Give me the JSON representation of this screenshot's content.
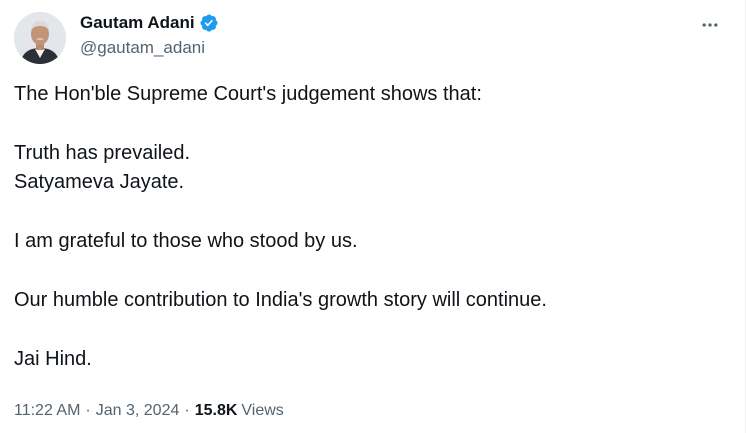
{
  "author": {
    "display_name": "Gautam Adani",
    "handle": "@gautam_adani",
    "verified": true,
    "verified_color": "#1d9bf0"
  },
  "tweet": {
    "paragraphs": [
      [
        "The Hon'ble Supreme Court's judgement shows that:"
      ],
      [
        "Truth has prevailed.",
        "Satyameva Jayate."
      ],
      [
        "I am grateful to those who stood by us."
      ],
      [
        "Our humble contribution to India's growth story will continue."
      ],
      [
        "Jai Hind."
      ]
    ]
  },
  "meta": {
    "time": "11:22 AM",
    "separator": "·",
    "date": "Jan 3, 2024",
    "views_count": "15.8K",
    "views_label": "Views"
  },
  "icons": {
    "more": "more-horizontal-icon",
    "verified": "verified-badge-icon"
  }
}
